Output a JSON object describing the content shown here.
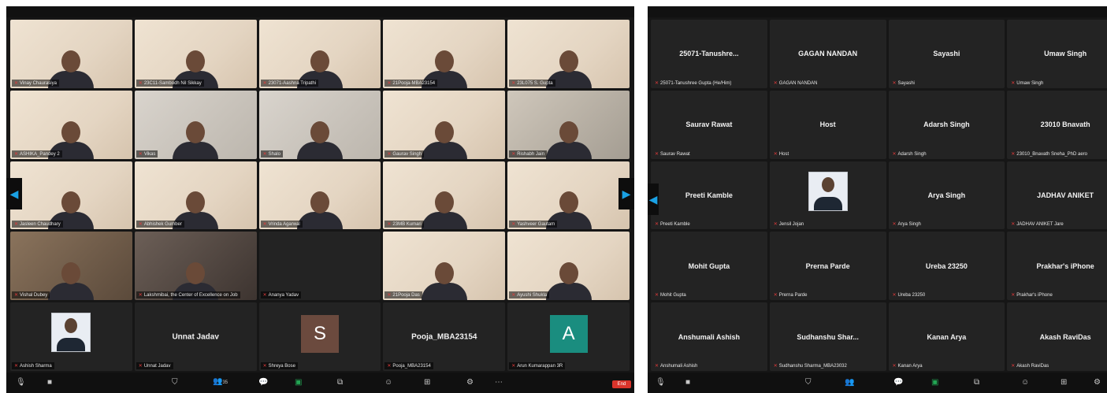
{
  "left_gallery": {
    "rows": [
      [
        {
          "name_tag": "Vinay Chaurasiya",
          "type": "video"
        },
        {
          "name_tag": "23C11-Sambodh Nil Sikkay",
          "type": "video"
        },
        {
          "name_tag": "23071-Aashna Tripathi",
          "type": "video"
        },
        {
          "name_tag": "21Pooja-MBA23154",
          "type": "video"
        },
        {
          "name_tag": "23L075 S. Gupta",
          "type": "video"
        }
      ],
      [
        {
          "name_tag": "ASHIKA_Pandey 2",
          "type": "video"
        },
        {
          "name_tag": "Vikas",
          "type": "video"
        },
        {
          "name_tag": "Shalo",
          "type": "video"
        },
        {
          "name_tag": "Gaurav Singh",
          "type": "video"
        },
        {
          "name_tag": "Rishabh Jain",
          "type": "video"
        }
      ],
      [
        {
          "name_tag": "Jasleen Chaudhary",
          "type": "video"
        },
        {
          "name_tag": "Abhishek Gumber",
          "type": "video"
        },
        {
          "name_tag": "Vrinda Agarwal",
          "type": "video"
        },
        {
          "name_tag": "23MB Kumari",
          "type": "video"
        },
        {
          "name_tag": "Yashveer Gautam",
          "type": "video"
        }
      ],
      [
        {
          "name_tag": "Vishal Dubey",
          "type": "video"
        },
        {
          "name_tag": "Lakshmibai, the Center of Excellence on Job",
          "type": "video"
        },
        {
          "name_tag": "Ananya Yadav",
          "type": "dark"
        },
        {
          "name_tag": "21Pooja Das",
          "type": "video"
        },
        {
          "name_tag": "Ayushi Shukla",
          "type": "video"
        }
      ],
      [
        {
          "name_tag": "Ashish Sharma",
          "type": "photo"
        },
        {
          "name_tag": "Unnat Jadav",
          "type": "named",
          "center": "Unnat Jadav"
        },
        {
          "name_tag": "Shreya Bose",
          "type": "letter",
          "letter": "S",
          "color": "#6b4a3e"
        },
        {
          "name_tag": "Pooja_MBA23154",
          "type": "named",
          "center": "Pooja_MBA23154"
        },
        {
          "name_tag": "Arun Kumarappan 3R",
          "type": "letter",
          "letter": "A",
          "color": "#1a8d7f"
        }
      ]
    ]
  },
  "right_gallery": {
    "rows": [
      [
        {
          "center": "25071-Tanushre...",
          "name_tag": "25071-Tanushree Gupta (He/Him)"
        },
        {
          "center": "GAGAN NANDAN",
          "name_tag": "GAGAN NANDAN"
        },
        {
          "center": "Sayashi",
          "name_tag": "Sayashi"
        },
        {
          "center": "Umaw Singh",
          "name_tag": "Umaw Singh"
        }
      ],
      [
        {
          "center": "Saurav Rawat",
          "name_tag": "Saurav Rawat"
        },
        {
          "center": "Host",
          "name_tag": "Host"
        },
        {
          "center": "Adarsh Singh",
          "name_tag": "Adarsh Singh"
        },
        {
          "center": "23010 Bnavath",
          "name_tag": "23010_Bnavath Sneha_PhD aero"
        }
      ],
      [
        {
          "center": "Preeti Kamble",
          "name_tag": "Preeti Kamble"
        },
        {
          "center": "",
          "name_tag": "Jensil Jojan",
          "photo": true
        },
        {
          "center": "Arya Singh",
          "name_tag": "Arya Singh"
        },
        {
          "center": "JADHAV ANIKET",
          "name_tag": "JADHAV ANIKET Jare"
        }
      ],
      [
        {
          "center": "Mohit Gupta",
          "name_tag": "Mohit Gupta"
        },
        {
          "center": "Prerna Parde",
          "name_tag": "Prerna Parde"
        },
        {
          "center": "Ureba 23250",
          "name_tag": "Ureba 23250"
        },
        {
          "center": "Prakhar's iPhone",
          "name_tag": "Prakhar's iPhone"
        }
      ],
      [
        {
          "center": "Anshumali Ashish",
          "name_tag": "Anshumali Ashish"
        },
        {
          "center": "Sudhanshu Shar...",
          "name_tag": "Sudhanshu Sharma_MBA23032"
        },
        {
          "center": "Kanan Arya",
          "name_tag": "Kanan Arya"
        },
        {
          "center": "Akash RaviDas",
          "name_tag": "Akash RaviDas"
        }
      ]
    ]
  },
  "toolbar": {
    "audio_icon": "microphone-icon",
    "video_icon": "camera-icon",
    "security_icon": "shield-icon",
    "participants_icon": "people-icon",
    "participants_count": "35",
    "chat_icon": "chat-icon",
    "share_icon": "share-screen-icon",
    "record_icon": "record-icon",
    "reactions_icon": "reaction-icon",
    "apps_icon": "apps-icon",
    "more_icon": "more-icon",
    "end_label": "End"
  },
  "colors": {
    "background": "#161616",
    "tile_dark": "#232323",
    "nav_arrow": "#1aa1e4",
    "end_button": "#d9342b",
    "share_green": "#23a654"
  }
}
